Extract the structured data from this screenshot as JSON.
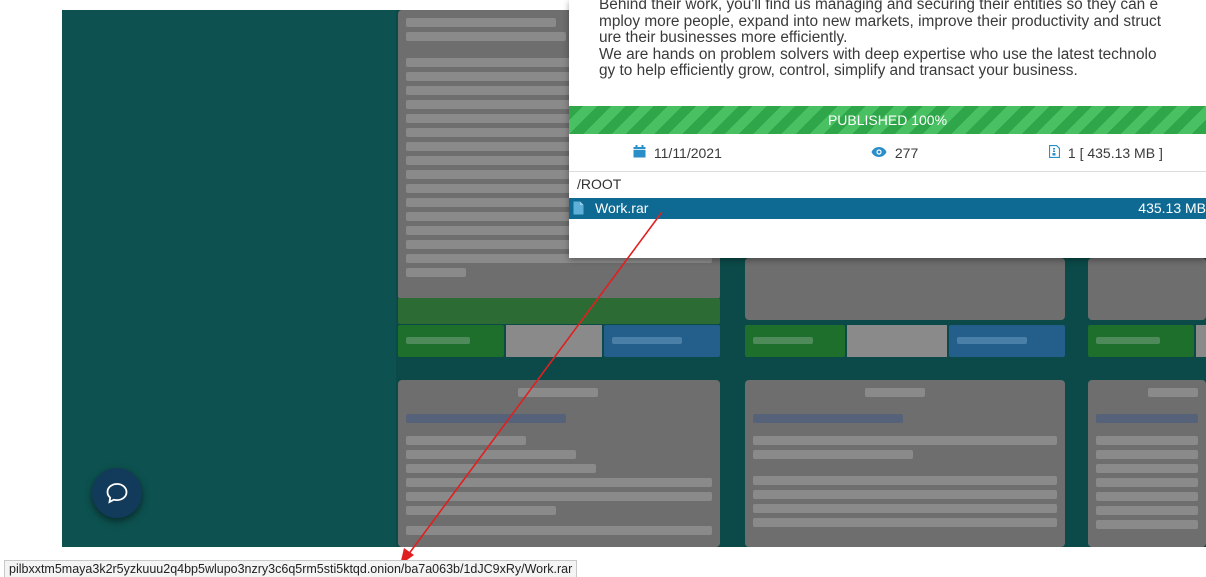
{
  "popup": {
    "description_lines": [
      "Behind their work, you'll find us managing and securing their entities so they can e",
      "mploy more people, expand into new markets, improve their productivity and struct",
      "ure their businesses more efficiently.",
      "We are hands on problem solvers with deep expertise who use the latest technolo",
      "gy to help efficiently grow, control, simplify and transact your business."
    ],
    "progress_label": "PUBLISHED 100%",
    "progress_fraction": 1.0,
    "date": "11/11/2021",
    "views": "277",
    "files": "1 [ 435.13 MB ]",
    "root_label": "/ROOT",
    "file": {
      "name": "Work.rar",
      "size": "435.13 MB"
    }
  },
  "statusbar": {
    "url": "pilbxxtm5maya3k2r5yzkuuu2q4bp5wlupo3nzry3c6q5rm5sti5ktqd.onion/ba7a063b/1dJC9xRy/Work.rar"
  },
  "icons": {
    "calendar": "calendar-icon",
    "eye": "eye-icon",
    "files": "file-archive-icon",
    "file": "file-icon",
    "chat": "chat-bubble-icon"
  },
  "colors": {
    "progress": "#2fa64a",
    "selected_row": "#0e6a93",
    "icon_blue": "#2a8fc9",
    "annotation_arrow": "#e02020"
  }
}
